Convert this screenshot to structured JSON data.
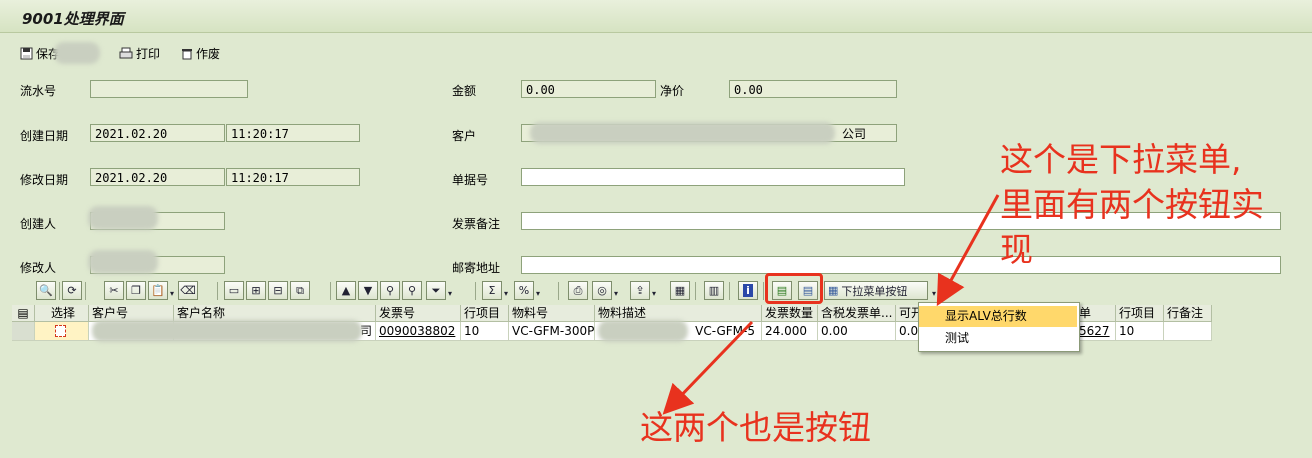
{
  "title": "9001处理界面",
  "appbar": {
    "save": "保存",
    "print": "打印",
    "void": "作废"
  },
  "form": {
    "serial_label": "流水号",
    "serial_value": "",
    "amount_label": "金额",
    "amount_value": "0.00",
    "net_label": "净价",
    "net_value": "0.00",
    "created_date_label": "创建日期",
    "created_date": "2021.02.20",
    "created_time": "11:20:17",
    "customer_label": "客户",
    "customer_suffix": "公司",
    "modified_date_label": "修改日期",
    "modified_date": "2021.02.20",
    "modified_time": "11:20:17",
    "doc_no_label": "单据号",
    "doc_no_value": "",
    "creator_label": "创建人",
    "invoice_note_label": "发票备注",
    "invoice_note_value": "",
    "modifier_label": "修改人",
    "mail_address_label": "邮寄地址",
    "mail_address_value": ""
  },
  "toolbar": {
    "dropdown_button": "下拉菜单按钮"
  },
  "columns": [
    "选择",
    "客户号",
    "客户名称",
    "发票号",
    "行项目",
    "物料号",
    "物料描述",
    "发票数量",
    "含税发票单...",
    "可开",
    "单",
    "行项目",
    "行备注"
  ],
  "row": {
    "customer_name_tail": "司",
    "invoice_no": "0090038802",
    "item": "10",
    "material": "VC-GFM-300P",
    "material_desc": "VC-GFM-5",
    "qty": "24.000",
    "price": "0.00",
    "open": "0.0",
    "doc_tail": "5627",
    "item2": "10",
    "note": ""
  },
  "dropdown_menu": {
    "items": [
      "显示ALV总行数",
      "测试"
    ]
  },
  "annotations": {
    "top": [
      "这个是下拉菜单,",
      "里面有两个按钮实",
      "现"
    ],
    "bottom": "这两个也是按钮"
  },
  "colors": {
    "annotation": "#e8321e",
    "background": "#dfe9d0",
    "highlight": "#ffd86b"
  }
}
